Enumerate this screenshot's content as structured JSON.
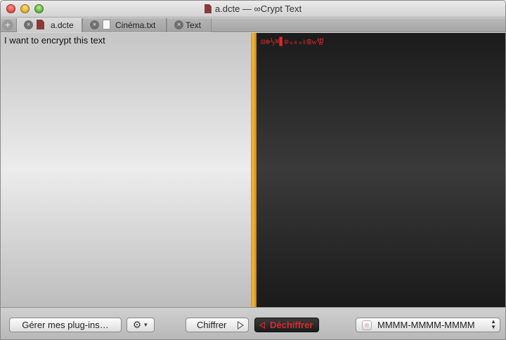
{
  "window": {
    "title": "a.dcte — ∞Crypt Text"
  },
  "tabs": [
    {
      "label": "a.dcte",
      "icon": "encrypted-doc-icon",
      "active": true
    },
    {
      "label": "Cinéma.txt",
      "icon": "text-file-icon",
      "active": false
    },
    {
      "label": "Text",
      "icon": null,
      "active": false
    }
  ],
  "editor": {
    "plain_text": "I want to encrypt this text",
    "cipher_text": "⊡⊕⅓⌘▋⊙ₐ₀ₒ≀⁄≣ᴡ벟"
  },
  "toolbar": {
    "plugins_label": "Gérer mes plug-ins…",
    "gear_icon": "gear-icon",
    "encrypt_label": "Chiffrer",
    "decrypt_label": "Déchiffrer",
    "key_select_value": "MMMM-MMMM-MMMM"
  },
  "colors": {
    "divider": "#f2b63a",
    "cipher_text": "#e0282e",
    "right_pane_bg": "#2a2a2a"
  }
}
